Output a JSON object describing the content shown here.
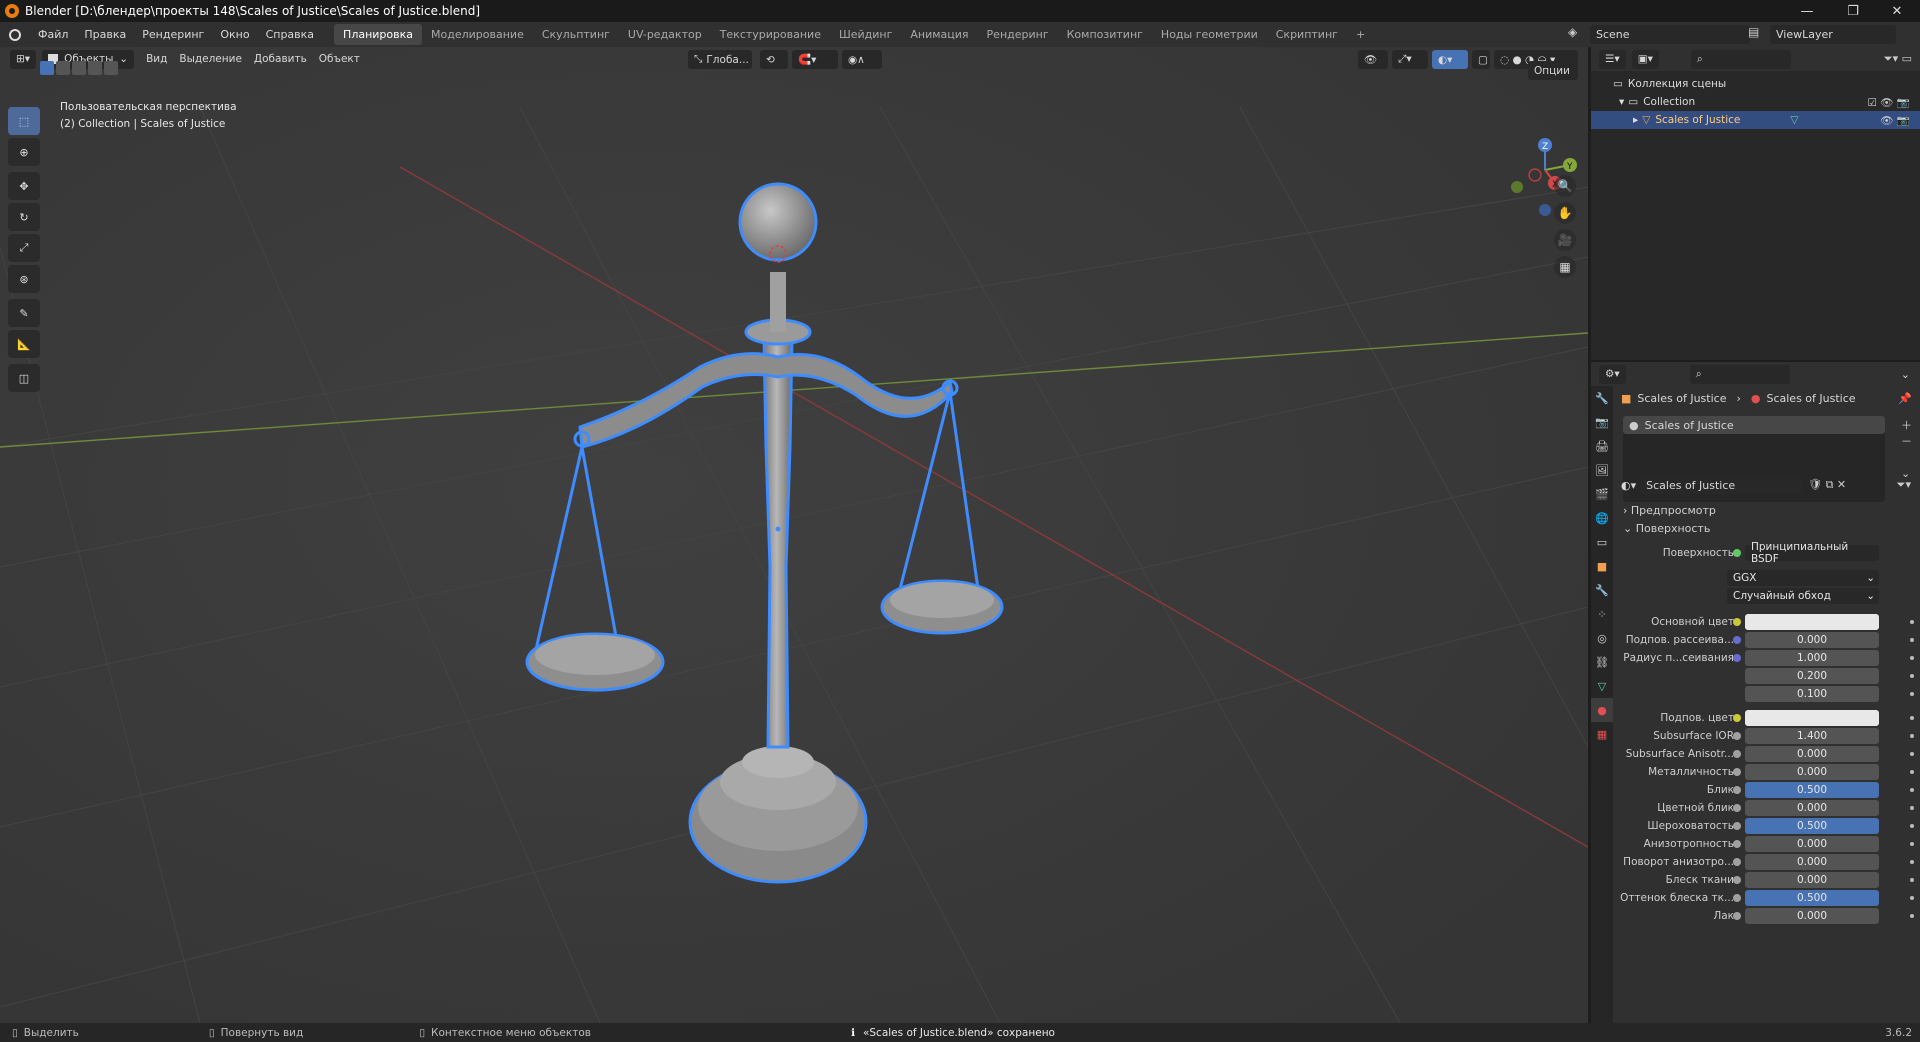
{
  "window": {
    "title": "Blender [D:\\блендер\\проекты 148\\Scales of Justice\\Scales of Justice.blend]"
  },
  "menu": [
    "Файл",
    "Правка",
    "Рендеринг",
    "Окно",
    "Справка"
  ],
  "workspaces": [
    "Планировка",
    "Моделирование",
    "Скульптинг",
    "UV-редактор",
    "Текстурирование",
    "Шейдинг",
    "Анимация",
    "Рендеринг",
    "Композитинг",
    "Ноды геометрии",
    "Скриптинг",
    "+"
  ],
  "scene": {
    "label": "Scene",
    "view_layer": "ViewLayer"
  },
  "viewport": {
    "mode": "Объекты",
    "menus": [
      "Вид",
      "Выделение",
      "Добавить",
      "Объект"
    ],
    "orientation": "Глоба...",
    "options": "Опции",
    "info_line1": "Пользовательская перспектива",
    "info_line2": "(2) Collection | Scales of Justice"
  },
  "outliner": {
    "root": "Коллекция сцены",
    "collection": "Collection",
    "object": "Scales of Justice"
  },
  "properties": {
    "breadcrumb_object": "Scales of Justice",
    "breadcrumb_material": "Scales of Justice",
    "slot": "Scales of Justice",
    "material_name": "Scales of Justice",
    "preview_panel": "Предпросмотр",
    "surface_panel": "Поверхность",
    "surface_label": "Поверхность",
    "surface_value": "Принципиальный BSDF",
    "distribution": "GGX",
    "subsurface_method": "Случайный обход",
    "rows": [
      {
        "label": "Основной цвет",
        "value": "",
        "kind": "white",
        "dot": "#c8c83a"
      },
      {
        "label": "Подпов. рассеива...",
        "value": "0.000",
        "kind": "num",
        "dot": "#6a6ad0"
      },
      {
        "label": "Радиус п...сеивания",
        "value": "1.000",
        "kind": "num",
        "dot": "#6a6ad0"
      },
      {
        "label": "",
        "value": "0.200",
        "kind": "num",
        "dot": ""
      },
      {
        "label": "",
        "value": "0.100",
        "kind": "num",
        "dot": ""
      },
      {
        "label": "Подпов. цвет",
        "value": "",
        "kind": "white",
        "dot": "#c8c83a"
      },
      {
        "label": "Subsurface IOR",
        "value": "1.400",
        "kind": "num",
        "dot": "#a0a0a0"
      },
      {
        "label": "Subsurface Anisotr...",
        "value": "0.000",
        "kind": "num",
        "dot": "#a0a0a0"
      },
      {
        "label": "Металличность",
        "value": "0.000",
        "kind": "num",
        "dot": "#a0a0a0"
      },
      {
        "label": "Блик",
        "value": "0.500",
        "kind": "blue",
        "dot": "#a0a0a0"
      },
      {
        "label": "Цветной блик",
        "value": "0.000",
        "kind": "num",
        "dot": "#a0a0a0"
      },
      {
        "label": "Шероховатость",
        "value": "0.500",
        "kind": "blue",
        "dot": "#a0a0a0"
      },
      {
        "label": "Анизотропность",
        "value": "0.000",
        "kind": "num",
        "dot": "#a0a0a0"
      },
      {
        "label": "Поворот анизотро...",
        "value": "0.000",
        "kind": "num",
        "dot": "#a0a0a0"
      },
      {
        "label": "Блеск ткани",
        "value": "0.000",
        "kind": "num",
        "dot": "#a0a0a0"
      },
      {
        "label": "Оттенок блеска тк...",
        "value": "0.500",
        "kind": "blue",
        "dot": "#a0a0a0"
      },
      {
        "label": "Лак",
        "value": "0.000",
        "kind": "num",
        "dot": "#a0a0a0"
      }
    ]
  },
  "status": {
    "select": "Выделить",
    "rotate": "Повернуть вид",
    "context": "Контекстное меню объектов",
    "message": "«Scales of Justice.blend» сохранено",
    "version": "3.6.2"
  },
  "colors": {
    "accent": "#4772b3",
    "selection_outline": "#3f8cff",
    "header": "#303030"
  }
}
